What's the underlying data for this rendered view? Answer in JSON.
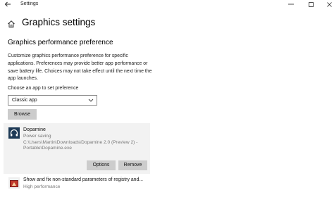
{
  "window": {
    "title": "Settings",
    "back_icon": "back-arrow-icon",
    "controls": [
      "minimize-icon",
      "maximize-icon",
      "close-icon"
    ]
  },
  "page": {
    "home_icon": "home-icon",
    "title": "Graphics settings"
  },
  "section": {
    "title": "Graphics performance preference",
    "description": "Customize graphics performance preference for specific applications. Preferences may provide better app performance or save battery life. Choices may not take effect until the next time the app launches."
  },
  "chooser": {
    "label": "Choose an app to set preference",
    "selected": "Classic app",
    "browse_label": "Browse"
  },
  "apps": [
    {
      "name": "Dopamine",
      "preference": "Power saving",
      "path_line1": "C:\\Users\\Martin\\Downloads\\Dopamine 2.0 (Preview 2) -",
      "path_line2": "Portable\\Dopamine.exe",
      "options_label": "Options",
      "remove_label": "Remove",
      "icon": "headphones-icon"
    },
    {
      "name": "Show and fix non-standard parameters of registry and...",
      "preference": "High performance",
      "icon": "registry-tool-icon"
    }
  ],
  "colors": {
    "card_bg": "#f2f2f2",
    "button_bg": "#cccccc",
    "secondary_text": "#777777"
  }
}
